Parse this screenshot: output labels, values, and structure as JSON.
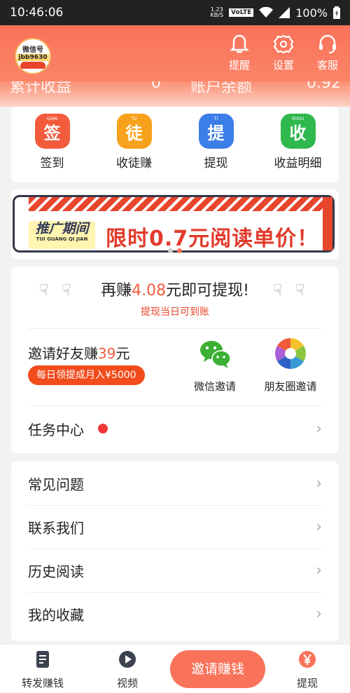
{
  "status": {
    "time": "10:46:06",
    "speed_value": "1.23",
    "speed_unit": "KB/S",
    "volte": "VoLTE",
    "battery": "100%"
  },
  "header": {
    "logo_line1": "微信号",
    "logo_line2": "jbb9630",
    "remind": "提醒",
    "settings": "设置",
    "service": "客服"
  },
  "stats": {
    "total_income_label": "累计收益",
    "total_income_value": "0",
    "balance_label": "账户余额",
    "balance_value": "0.92"
  },
  "quick": [
    {
      "label": "签到",
      "icon_char": "签",
      "pinyin": "QIAN",
      "color": "#f25b3c",
      "icon": "checkin-icon"
    },
    {
      "label": "收徒赚",
      "icon_char": "徒",
      "pinyin": "TU",
      "color": "#f7a21d",
      "icon": "apprentice-icon"
    },
    {
      "label": "提现",
      "icon_char": "提",
      "pinyin": "TI",
      "color": "#3b7ee8",
      "icon": "withdraw-icon"
    },
    {
      "label": "收益明细",
      "icon_char": "收",
      "pinyin": "SHOU",
      "color": "#2eb84d",
      "icon": "income-icon"
    }
  ],
  "banner": {
    "tag_line1": "推广期间",
    "tag_line2": "TUI GUANG QI JIAN",
    "headline": "限时0.7元阅读单价！"
  },
  "withdraw": {
    "prefix": "再赚",
    "amount": "4.08",
    "suffix": "元即可提现!",
    "sub": "提现当日可到账"
  },
  "invite": {
    "title_prefix": "邀请好友赚",
    "title_amount": "39",
    "title_suffix": "元",
    "badge": "每日领提成月入¥5000",
    "wechat": "微信邀请",
    "moments": "朋友圈邀请"
  },
  "task": {
    "label": "任务中心"
  },
  "list": [
    "常见问题",
    "联系我们",
    "历史阅读",
    "我的收藏"
  ],
  "nav": {
    "forward": "转发赚钱",
    "video": "视频",
    "invite": "邀请赚钱",
    "withdraw": "提现"
  },
  "colors": {
    "accent": "#f9725a",
    "highlight": "#f25b3c"
  }
}
